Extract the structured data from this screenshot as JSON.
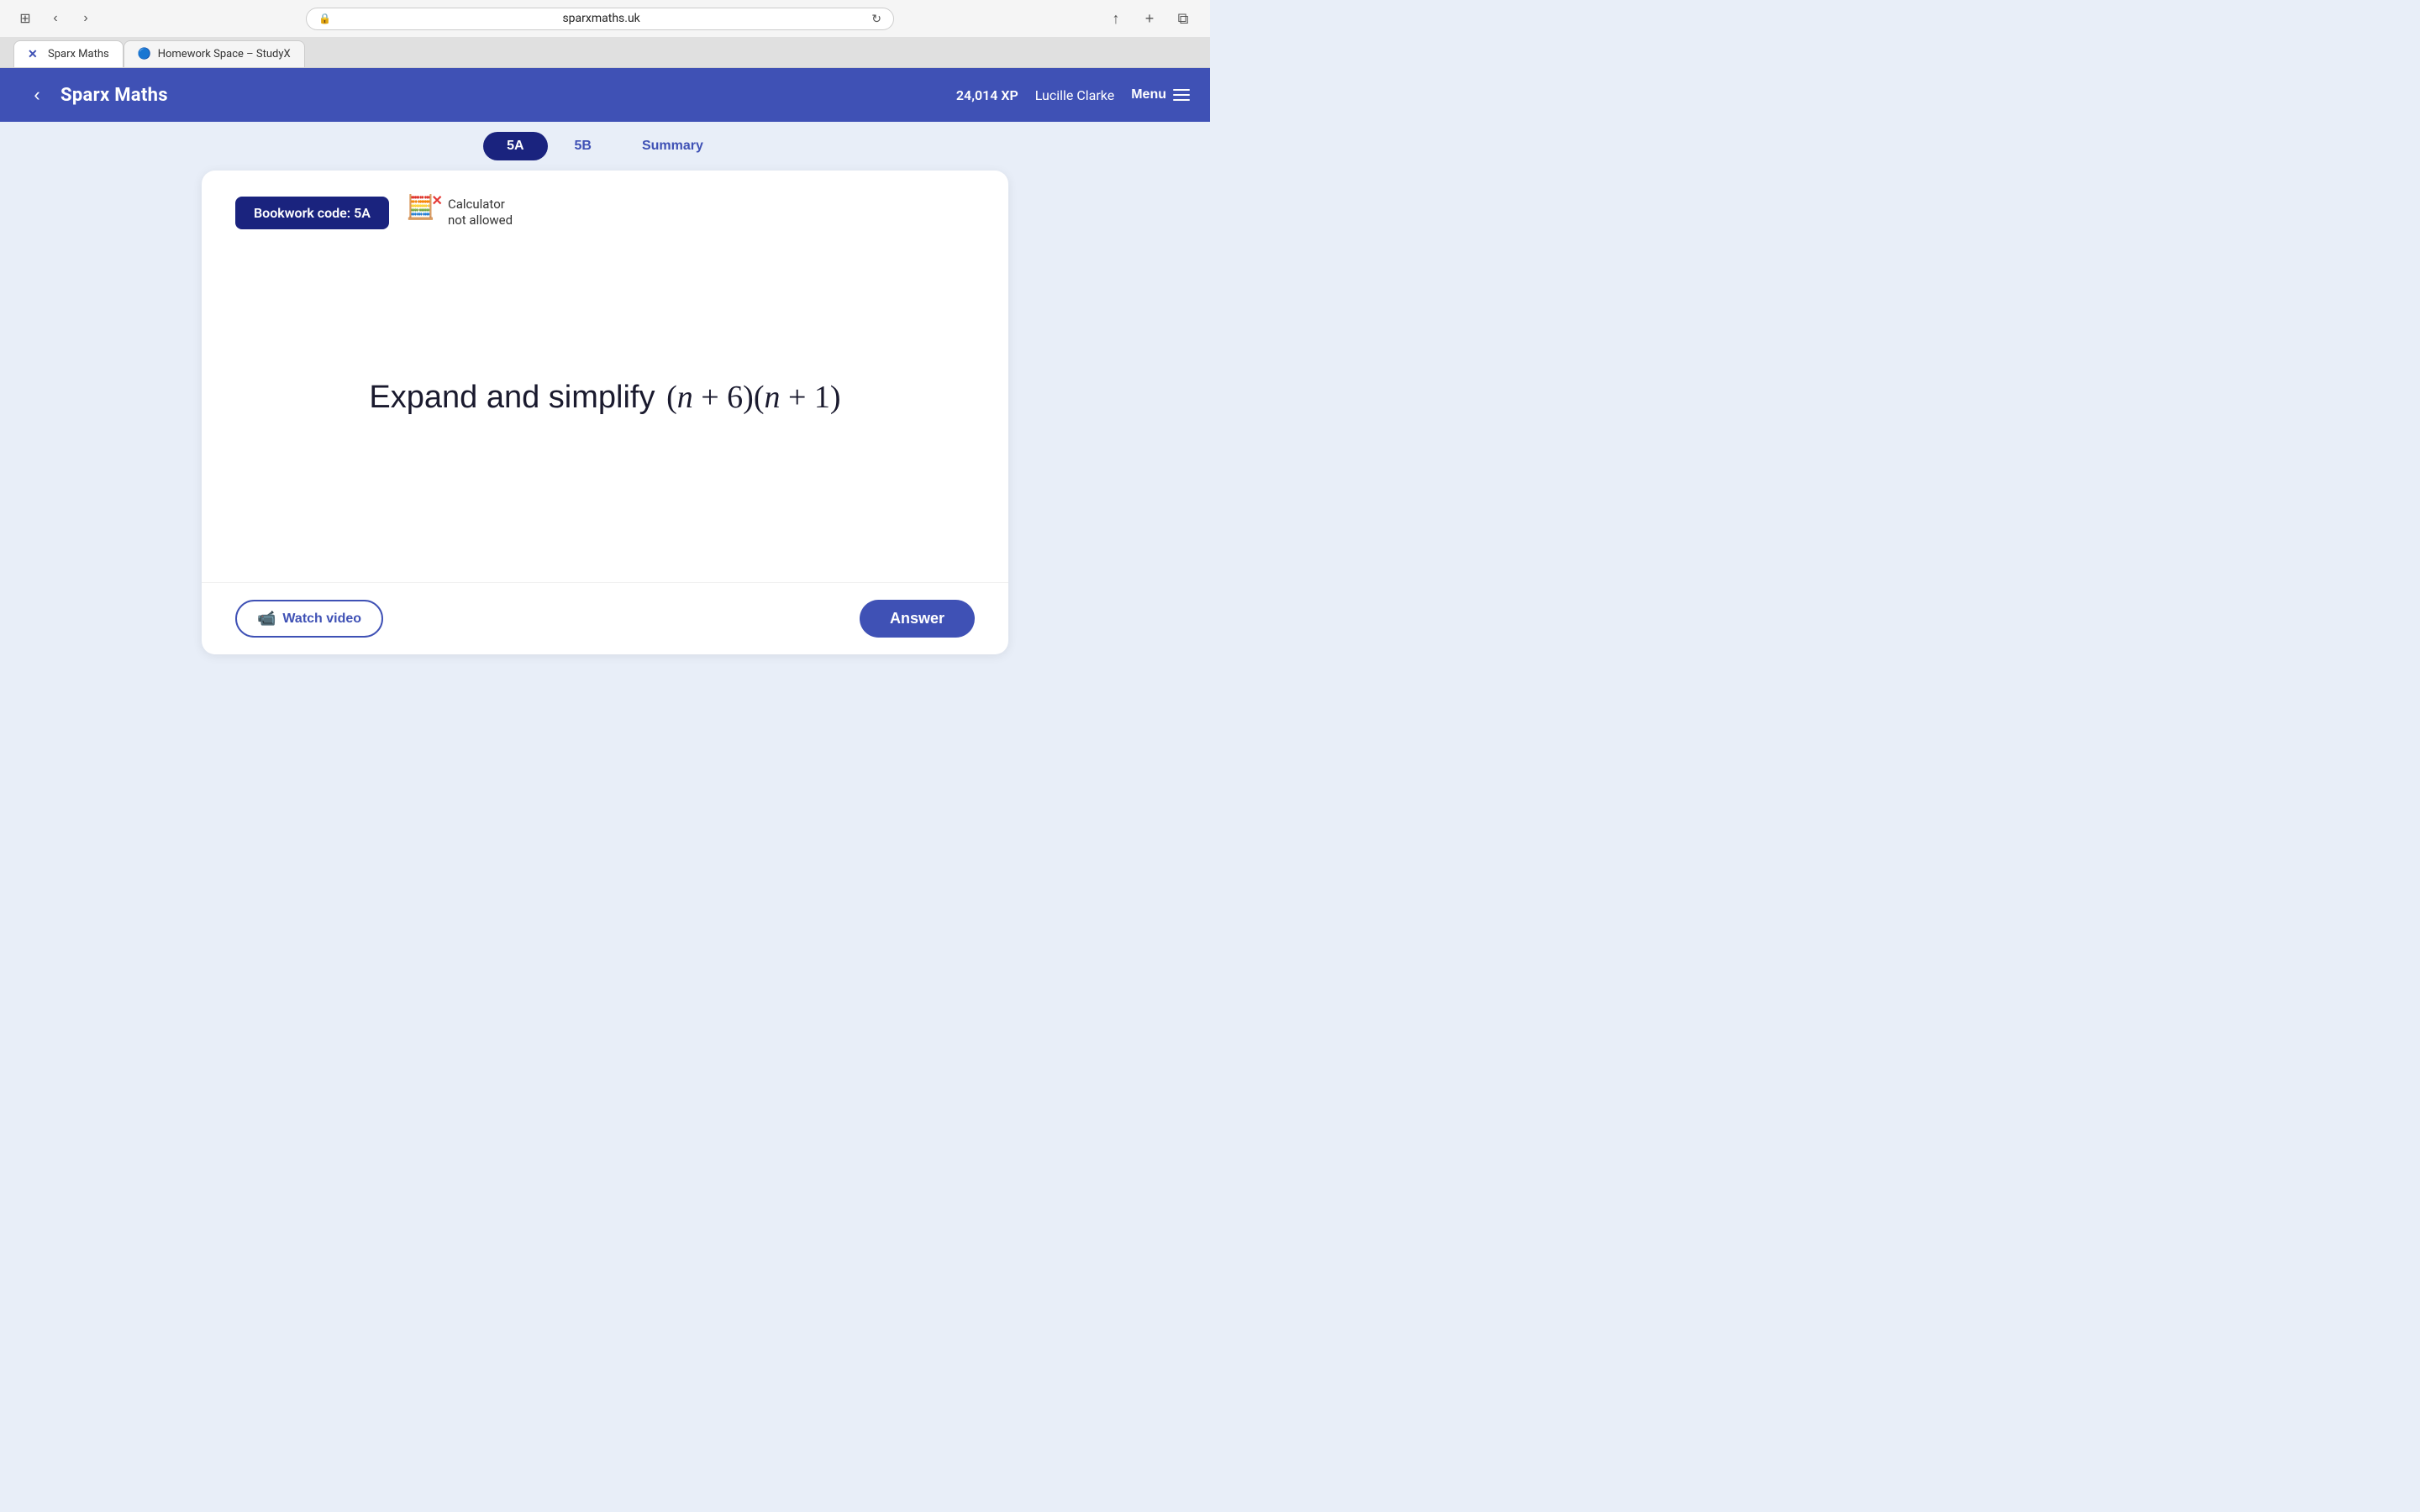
{
  "browser": {
    "address": "sparxmaths.uk",
    "reload_title": "Reload page",
    "tabs": [
      {
        "id": "sparx",
        "label": "Sparx Maths",
        "icon": "✖",
        "icon_color": "#3f51b5",
        "active": true
      },
      {
        "id": "studyx",
        "label": "Homework Space – StudyX",
        "icon": "🔵",
        "active": false
      }
    ],
    "actions": {
      "share": "↑",
      "new_tab": "+",
      "windows": "⊞"
    }
  },
  "header": {
    "logo": "Sparx Maths",
    "xp": "24,014 XP",
    "user": "Lucille Clarke",
    "menu_label": "Menu"
  },
  "tabs": [
    {
      "id": "5a",
      "label": "5A",
      "active": true
    },
    {
      "id": "5b",
      "label": "5B",
      "active": false
    },
    {
      "id": "summary",
      "label": "Summary",
      "active": false
    }
  ],
  "card": {
    "bookwork_code": "Bookwork code: 5A",
    "calculator_label": "Calculator",
    "calculator_status": "not allowed",
    "question_text": "Expand and simplify (n + 6)(n + 1)",
    "watch_video_label": "Watch video",
    "answer_label": "Answer"
  }
}
